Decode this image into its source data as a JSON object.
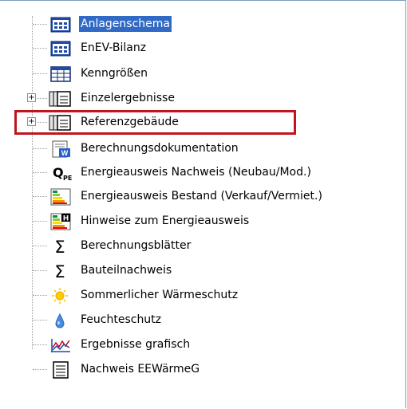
{
  "tree": {
    "items": [
      {
        "label": "Anlagenschema",
        "icon": "schema-icon",
        "selected": true
      },
      {
        "label": "EnEV-Bilanz",
        "icon": "schema-icon"
      },
      {
        "label": "Kenngrößen",
        "icon": "table-icon"
      },
      {
        "label": "Einzelergebnisse",
        "icon": "documents-icon",
        "expander": "+"
      },
      {
        "label": "Referenzgebäude",
        "icon": "documents-icon",
        "expander": "+",
        "highlighted": true
      },
      {
        "label": "Berechnungsdokumentation",
        "icon": "word-doc-icon"
      },
      {
        "label": "Energieausweis Nachweis (Neubau/Mod.)",
        "icon": "q-pe-icon",
        "icon_text": "Q",
        "icon_sub": "PE"
      },
      {
        "label": "Energieausweis Bestand (Verkauf/Vermiet.)",
        "icon": "energy-bars-icon"
      },
      {
        "label": "Hinweise zum Energieausweis",
        "icon": "energy-bars-h-icon",
        "icon_text": "H"
      },
      {
        "label": "Berechnungsblätter",
        "icon": "sigma-icon",
        "icon_text": "Σ"
      },
      {
        "label": "Bauteilnachweis",
        "icon": "sigma-icon",
        "icon_text": "Σ"
      },
      {
        "label": "Sommerlicher Wärmeschutz",
        "icon": "sun-icon"
      },
      {
        "label": "Feuchteschutz",
        "icon": "drop-icon"
      },
      {
        "label": "Ergebnisse grafisch",
        "icon": "chart-icon"
      },
      {
        "label": "Nachweis EEWärmeG",
        "icon": "list-doc-icon"
      }
    ]
  },
  "colors": {
    "selection": "#316ac5",
    "highlight_border": "#c0151f"
  }
}
